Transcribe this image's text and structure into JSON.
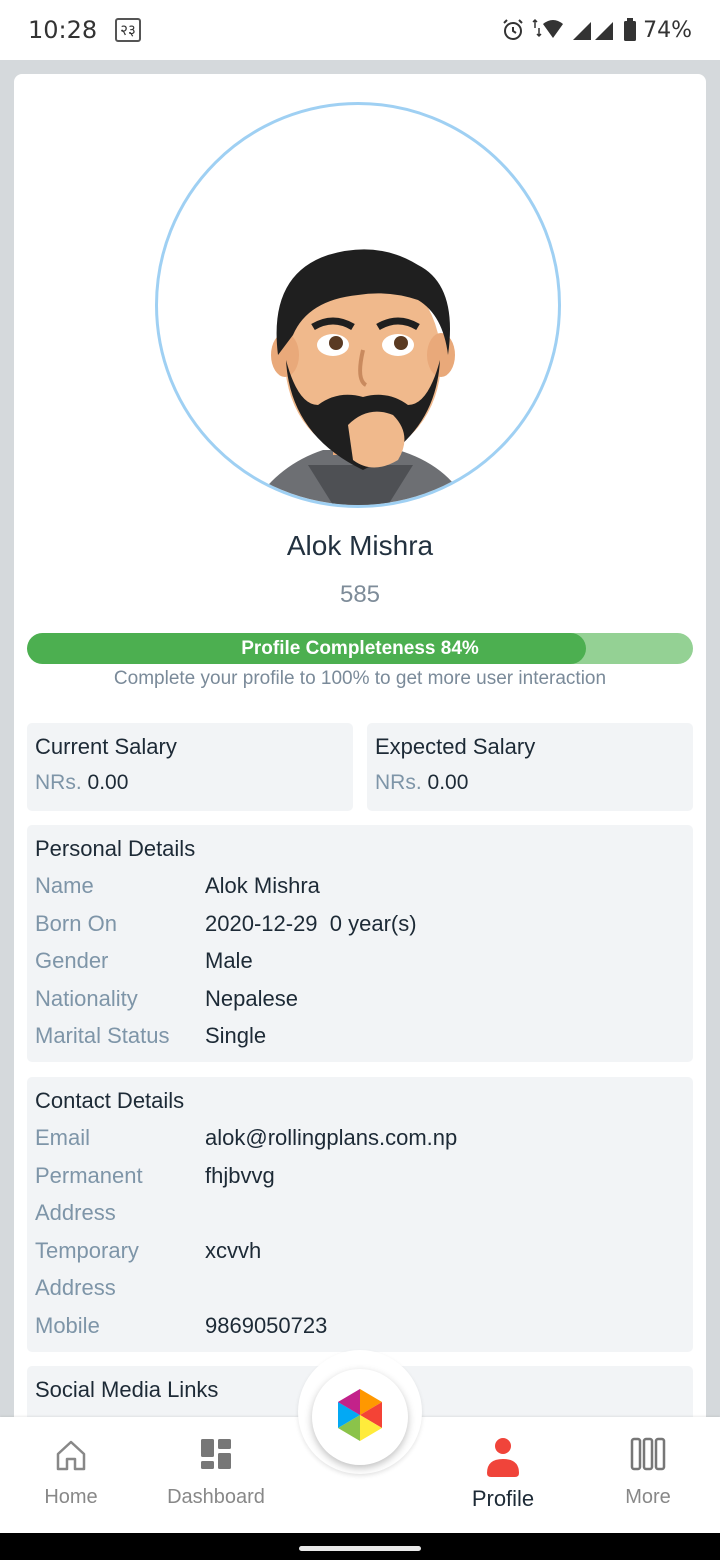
{
  "status_bar": {
    "time": "10:28",
    "sim_label": "२३",
    "battery": "74%"
  },
  "profile": {
    "name": "Alok Mishra",
    "score": "585",
    "completeness_label": "Profile Completeness 84%",
    "completeness_value": 0.84,
    "completeness_hint": "Complete your profile to 100% to get more user interaction"
  },
  "salary": {
    "current": {
      "title": "Current Salary",
      "currency": "NRs.",
      "amount": "0.00"
    },
    "expected": {
      "title": "Expected Salary",
      "currency": "NRs.",
      "amount": "0.00"
    }
  },
  "personal": {
    "title": "Personal Details",
    "rows": [
      {
        "label": "Name",
        "value": "Alok Mishra"
      },
      {
        "label": "Born On",
        "value": "2020-12-29  0 year(s)"
      },
      {
        "label": "Gender",
        "value": "Male"
      },
      {
        "label": "Nationality",
        "value": "Nepalese"
      },
      {
        "label": "Marital Status",
        "value": "Single"
      }
    ]
  },
  "contact": {
    "title": "Contact Details",
    "email_label": "Email",
    "email": "alok@rollingplans.com.np",
    "permanent_label_1": "Permanent",
    "permanent_label_2": "Address",
    "permanent": "fhjbvvg",
    "temporary_label_1": "Temporary",
    "temporary_label_2": "Address",
    "temporary": "xcvvh",
    "mobile_label": "Mobile",
    "mobile": "9869050723"
  },
  "social": {
    "title": "Social Media Links"
  },
  "nav": {
    "home": "Home",
    "dashboard": "Dashboard",
    "profile": "Profile",
    "more": "More"
  },
  "colors": {
    "accent_green": "#4caf50",
    "active_red": "#f0443a",
    "ring_blue": "#9fd0f3"
  },
  "icons": [
    "alarm-icon",
    "wifi-icon",
    "signal-icon",
    "battery-icon",
    "home-icon",
    "dashboard-icon",
    "person-icon",
    "more-icon",
    "app-logo-icon"
  ]
}
